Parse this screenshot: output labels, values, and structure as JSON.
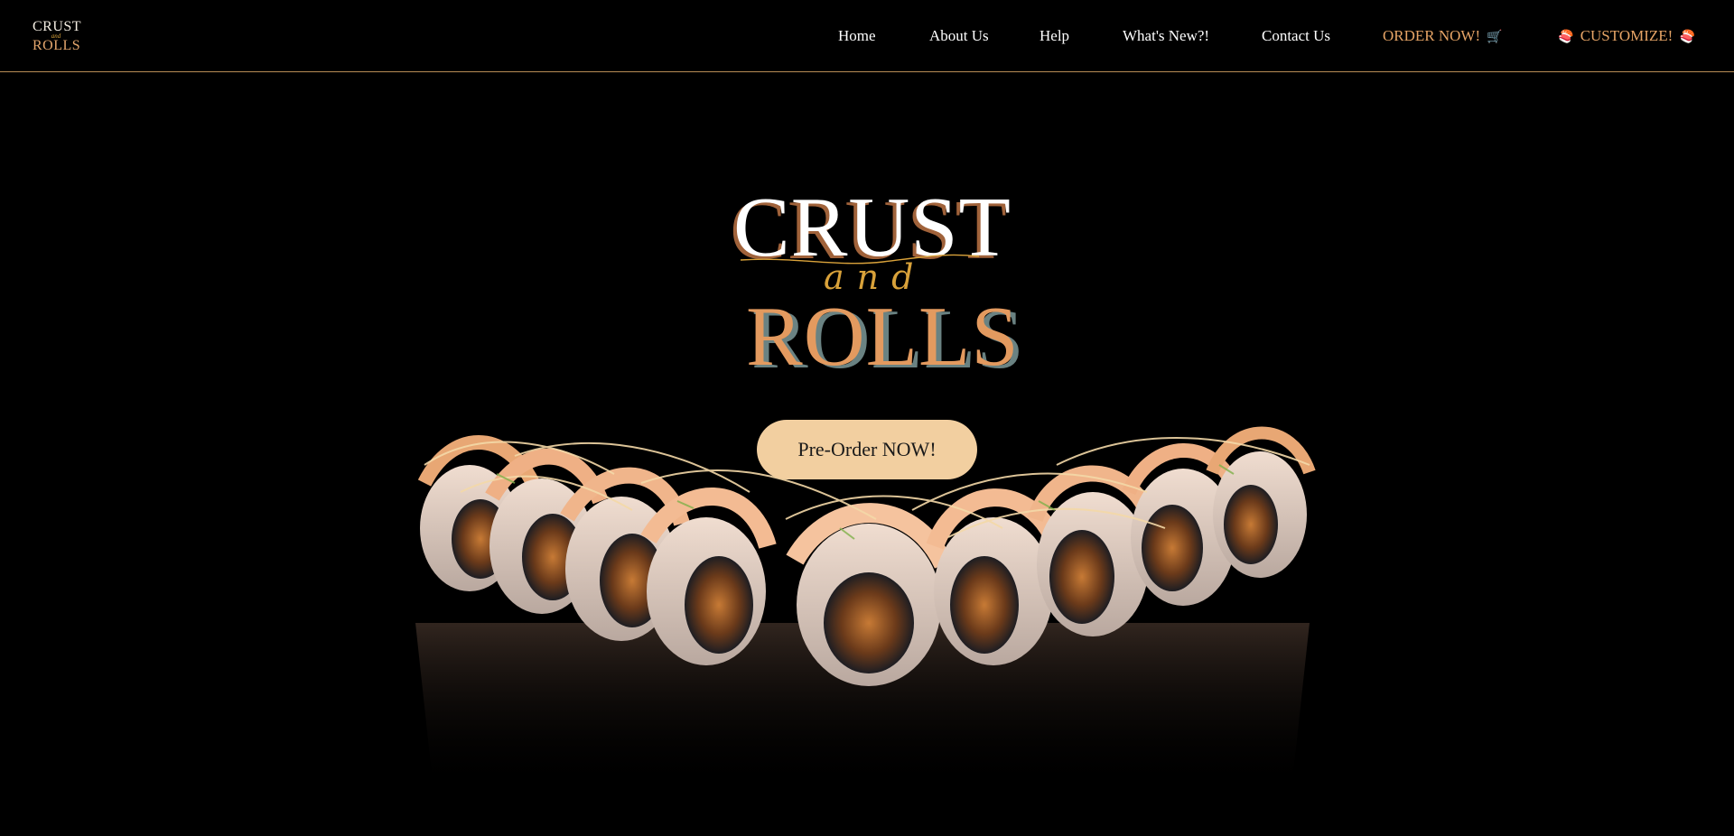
{
  "nav": {
    "logo": {
      "line1": "CRUST",
      "line2": "and",
      "line3": "ROLLS"
    },
    "links": [
      {
        "label": "Home"
      },
      {
        "label": "About Us"
      },
      {
        "label": "Help"
      },
      {
        "label": "What's New?!"
      },
      {
        "label": "Contact Us"
      },
      {
        "label": "ORDER NOW!",
        "icon": "cart-icon"
      },
      {
        "label": "CUSTOMIZE!",
        "icon_left": "sushi-icon",
        "icon_right": "sushi-icon"
      }
    ]
  },
  "hero": {
    "title_top": "CRUST",
    "title_middle": "and",
    "title_bottom": "ROLLS",
    "cta_label": "Pre-Order NOW!"
  },
  "colors": {
    "accent": "#e6a466",
    "button": "#f2cfa0",
    "divider": "#b88c55",
    "background": "#000000"
  }
}
